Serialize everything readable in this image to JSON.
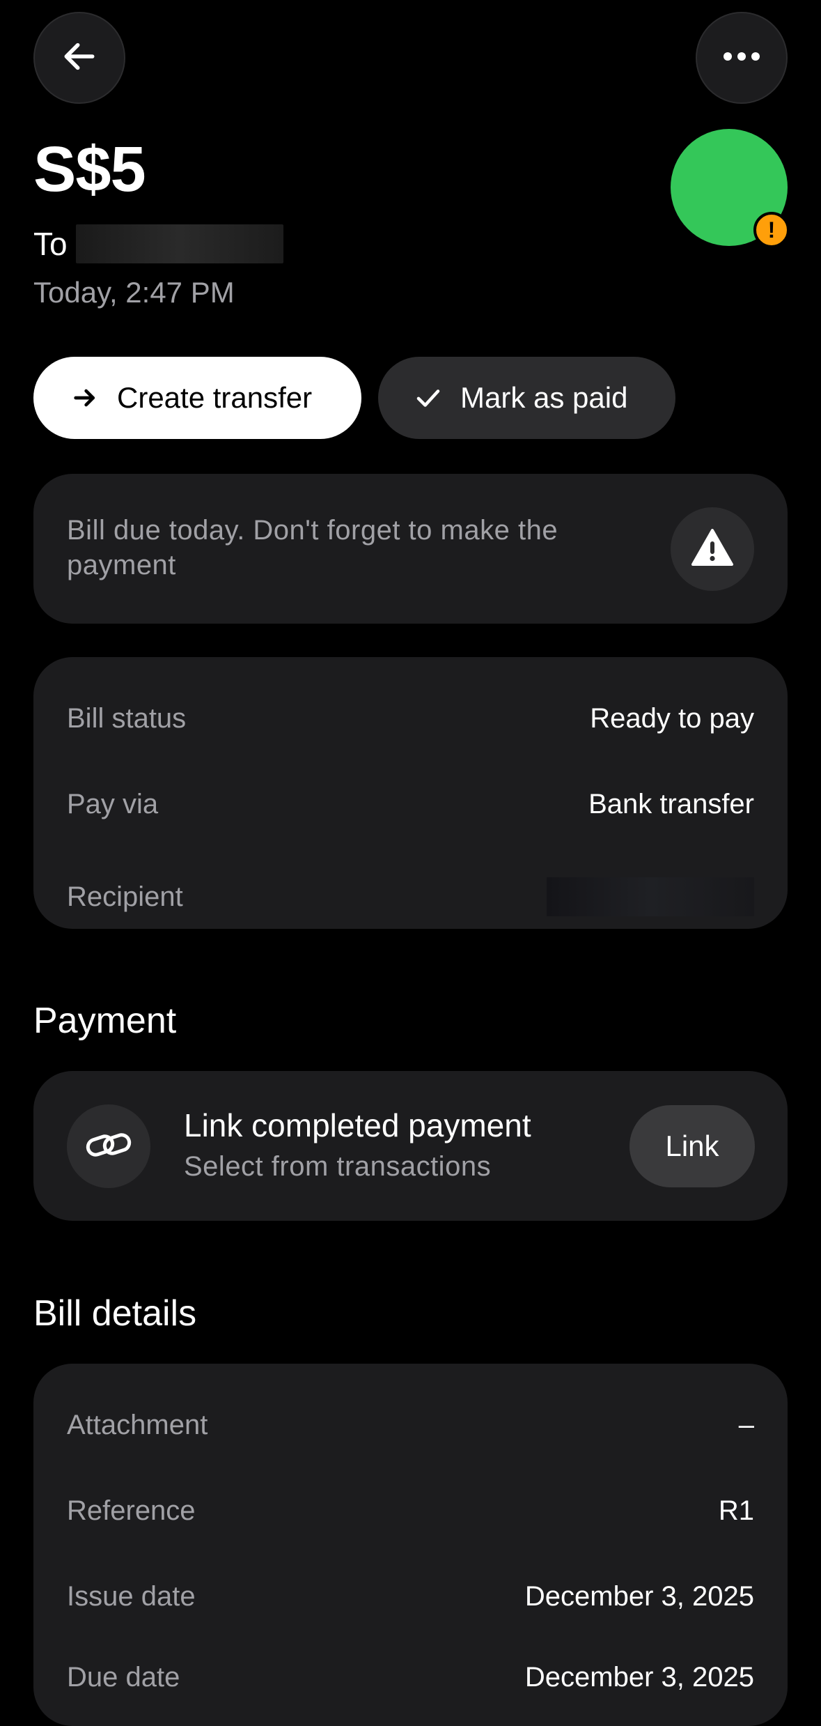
{
  "header": {
    "amount": "S$5",
    "to_label": "To",
    "timestamp": "Today, 2:47 PM",
    "back_icon": "arrow-left-icon",
    "more_icon": "ellipsis-icon",
    "avatar_color": "#34c759",
    "avatar_badge": "!",
    "avatar_badge_color": "#ff9f0a"
  },
  "actions": {
    "create_transfer": "Create transfer",
    "mark_as_paid": "Mark as paid"
  },
  "alert": {
    "message": "Bill due today. Don't forget to make the payment",
    "icon": "warning-triangle-icon"
  },
  "status": {
    "rows": [
      {
        "label": "Bill status",
        "value": "Ready to pay"
      },
      {
        "label": "Pay via",
        "value": "Bank transfer"
      },
      {
        "label": "Recipient",
        "value": ""
      }
    ]
  },
  "payment": {
    "section_title": "Payment",
    "title": "Link completed payment",
    "subtitle": "Select from transactions",
    "button": "Link",
    "icon": "link-chain-icon"
  },
  "bill_details": {
    "section_title": "Bill details",
    "rows": [
      {
        "label": "Attachment",
        "value": "–"
      },
      {
        "label": "Reference",
        "value": "R1"
      },
      {
        "label": "Issue date",
        "value": "December 3, 2025"
      },
      {
        "label": "Due date",
        "value": "December 3, 2025"
      }
    ]
  }
}
